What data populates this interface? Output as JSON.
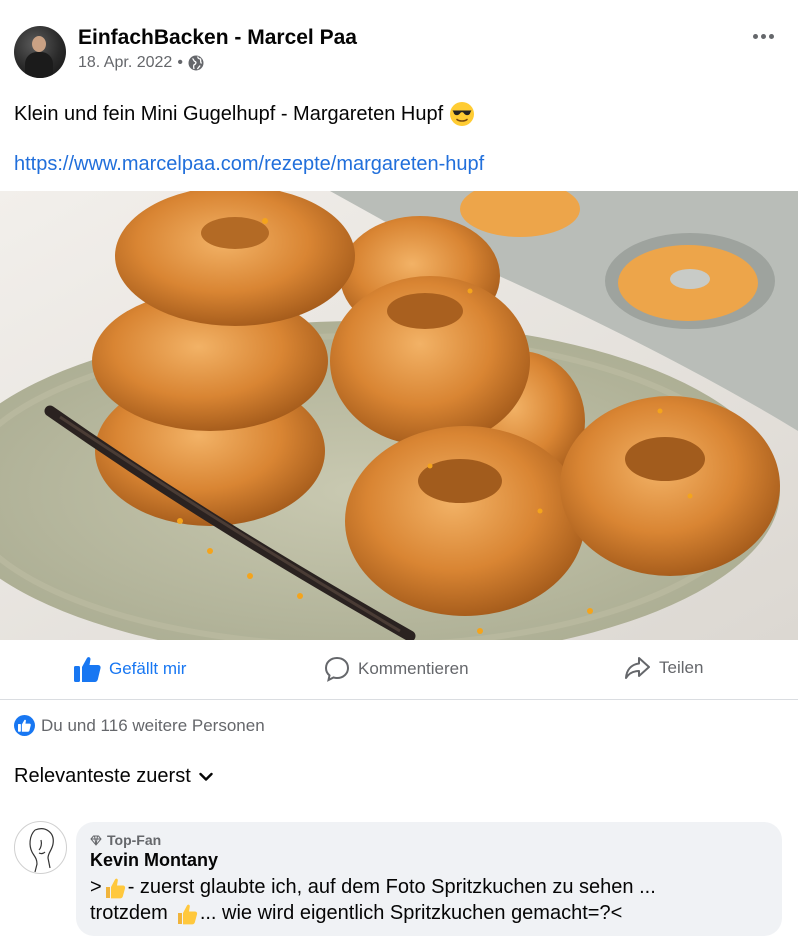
{
  "post": {
    "page_name": "EinfachBacken - Marcel Paa",
    "date": "18. Apr. 2022",
    "separator": "•",
    "audience_icon": "globe-icon",
    "text": "Klein und fein Mini Gugelhupf - Margareten Hupf",
    "text_emoji": "smiling-face-with-sunglasses",
    "link": "https://www.marcelpaa.com/rezepte/margareten-hupf",
    "more_icon": "more-horizontal-icon"
  },
  "actions": {
    "like_label": "Gefällt mir",
    "comment_label": "Kommentieren",
    "share_label": "Teilen",
    "like_color": "#1877f2"
  },
  "reactions": {
    "summary": "Du und 116 weitere Personen"
  },
  "comments_sort": {
    "label": "Relevanteste zuerst"
  },
  "comment": {
    "badge": "Top-Fan",
    "author": "Kevin Montany",
    "line1_prefix": ">",
    "line1_rest": "- zuerst glaubte  ich,  auf dem Foto Spritzkuchen zu sehen ...",
    "line2_prefix": "trotzdem",
    "line2_rest": " ... wie wird eigentlich Spritzkuchen gemacht=?<",
    "emoji": "thumbs-up"
  },
  "colors": {
    "link": "#216fdb",
    "secondary_text": "#65676b",
    "bubble": "#f0f2f5"
  }
}
